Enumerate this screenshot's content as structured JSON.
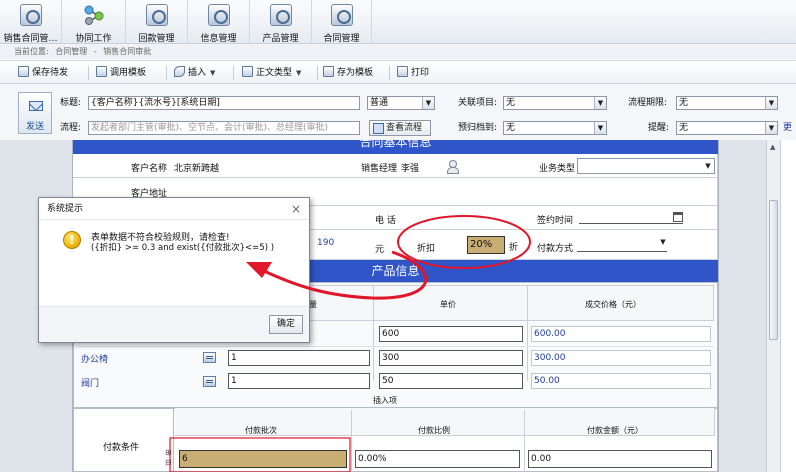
{
  "modules": [
    {
      "label": "销售合同管…",
      "icon": "contract-icon"
    },
    {
      "label": "协同工作",
      "icon": "network-icon"
    },
    {
      "label": "回款管理",
      "icon": "payment-icon"
    },
    {
      "label": "信息管理",
      "icon": "info-icon"
    },
    {
      "label": "产品管理",
      "icon": "product-icon"
    },
    {
      "label": "合同管理",
      "icon": "contract-manage-icon"
    }
  ],
  "breadcrumb": {
    "prefix": "当前位置:",
    "path1": "合同管理",
    "sep": "-",
    "path2": "销售合同审批"
  },
  "toolbar": {
    "save_draft": "保存待发",
    "use_template": "调用模板",
    "insert": "插入",
    "body_type": "正文类型",
    "save_as_template": "存为模板",
    "print": "打印"
  },
  "header": {
    "send": "发送",
    "title_label": "标题:",
    "title_value": "{客户名称}{流水号}[系统日期]",
    "priority_value": "普通",
    "related_label": "关联项目:",
    "related_value": "无",
    "deadline_label": "流程期限:",
    "deadline_value": "无",
    "flow_label": "流程:",
    "flow_placeholder": "发起者部门主管(审批)、空节点、会计(审批)、总经理(审批)",
    "view_flow": "查看流程",
    "archive_label": "预归档到:",
    "archive_value": "无",
    "remind_label": "提醒:",
    "remind_value": "无",
    "more": "更"
  },
  "contract_info": {
    "section_title": "合同基本信息",
    "customer_name_label": "客户名称",
    "customer_name_value": "北京新跨越",
    "sales_manager_label": "销售经理",
    "sales_manager_value": "李强",
    "business_type_label": "业务类型",
    "customer_address_label": "客户地址",
    "phone_label": "电 话",
    "sign_time_label": "签约时间",
    "amount_value": "190",
    "amount_unit": "元",
    "discount_label": "折扣",
    "discount_value": "20%",
    "discount_unit": "折",
    "payment_method_label": "付款方式"
  },
  "product_info": {
    "section_title": "产品信息",
    "col_qty": "量",
    "col_price": "单价",
    "col_total": "成交价格（元）",
    "rows": [
      {
        "name": "",
        "qty": "",
        "price": "600",
        "total": "600.00"
      },
      {
        "name": "办公椅",
        "qty": "1",
        "price": "300",
        "total": "300.00"
      },
      {
        "name": "阀门",
        "qty": "1",
        "price": "50",
        "total": "50.00"
      }
    ],
    "insert_row": "插入项"
  },
  "payment": {
    "label": "付款条件",
    "col_batch": "付款批次",
    "col_ratio": "付款比例",
    "col_amount": "付款金额（元）",
    "batch_value": "6",
    "ratio_value": "0.00%",
    "amount_value": "0.00"
  },
  "dialog": {
    "title": "系统提示",
    "close": "×",
    "message_line1": "表单数据不符合校验规则，请检查!",
    "message_line2": "({折扣} >= 0.3 and exist({付款批次}<=5) )",
    "ok": "确定"
  },
  "colors": {
    "section_header": "#2f55c9",
    "highlight_field": "#c8ae72",
    "annotation_red": "#e0162b",
    "link_blue": "#1f3c9c"
  }
}
